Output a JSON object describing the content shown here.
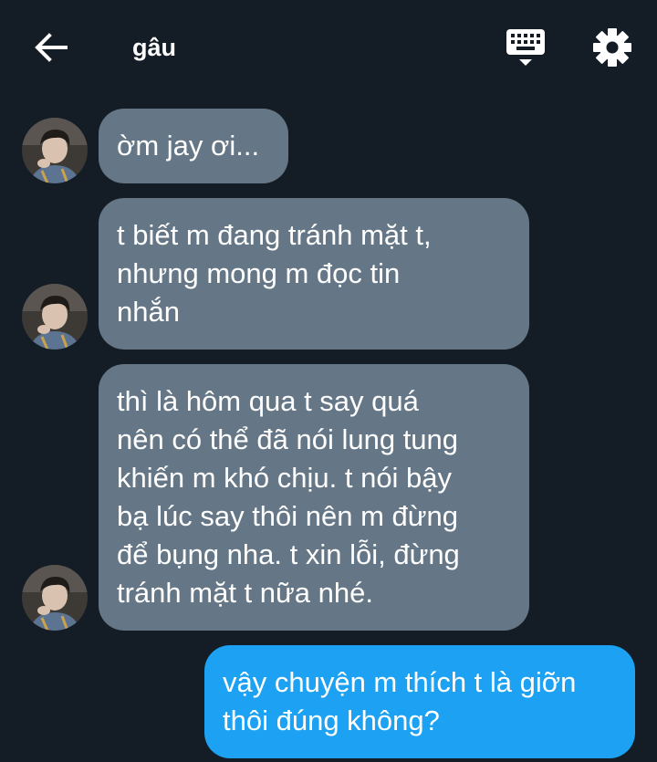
{
  "header": {
    "title": "gâu",
    "back_icon": "arrow-left-icon",
    "keyboard_icon": "keyboard-icon",
    "settings_icon": "gear-icon"
  },
  "messages": [
    {
      "sender": "contact",
      "text": "ờm jay ơi..."
    },
    {
      "sender": "contact",
      "text": "t biết m đang tránh mặt t,\nnhưng mong m đọc tin\nnhắn"
    },
    {
      "sender": "contact",
      "text": "thì là hôm qua t say quá\nnên có thể đã nói lung tung\nkhiến m khó chịu. t nói bậy\nbạ lúc say thôi nên m đừng\nđể bụng nha. t xin lỗi, đừng\ntránh mặt t nữa nhé."
    },
    {
      "sender": "me",
      "text": "vậy chuyện m thích t là giỡn\nthôi đúng không?"
    }
  ],
  "colors": {
    "background": "#141d26",
    "received_bubble": "#657786",
    "sent_bubble": "#1da1f2"
  }
}
